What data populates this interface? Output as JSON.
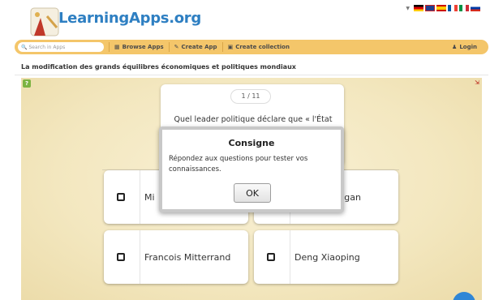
{
  "header": {
    "logo_text": "LearningApps.org",
    "languages": [
      "de",
      "en",
      "es",
      "fr",
      "it",
      "ru"
    ]
  },
  "navbar": {
    "search_placeholder": "Search in Apps",
    "browse_label": "Browse Apps",
    "create_label": "Create App",
    "collection_label": "Create collection",
    "login_label": "Login"
  },
  "page": {
    "title": "La modification des grands équilibres économiques et politiques mondiaux"
  },
  "quiz": {
    "counter": "1 / 11",
    "question": "Quel leader politique déclare que « l'État n'est pas la solution, il est le problème » ?",
    "answers": [
      {
        "label": "Mi"
      },
      {
        "label": "eagan"
      },
      {
        "label": "Francois Mitterrand"
      },
      {
        "label": "Deng Xiaoping"
      }
    ]
  },
  "modal": {
    "title": "Consigne",
    "text": "Répondez aux questions pour tester vos connaissances.",
    "ok_label": "OK"
  },
  "colors": {
    "navbar": "#f4c66a",
    "logo": "#2e7fc2",
    "app_bg": "#f3e7bf"
  }
}
